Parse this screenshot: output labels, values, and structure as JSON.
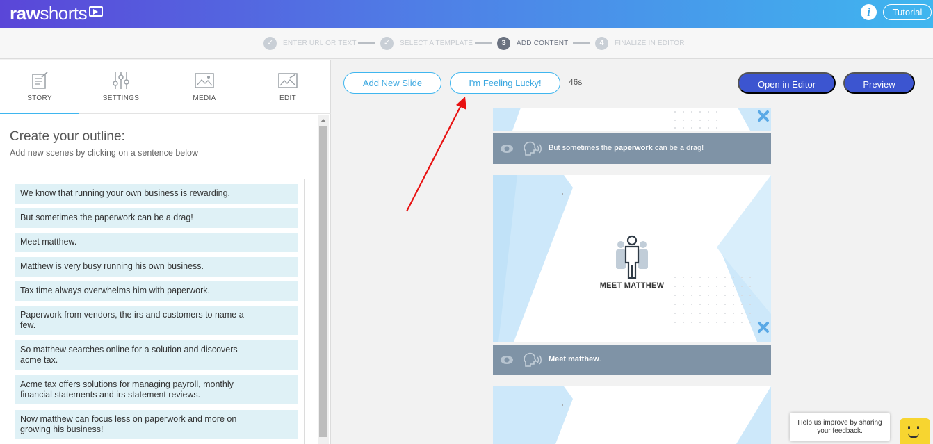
{
  "app": {
    "logo_bold": "raw",
    "logo_thin": "shorts",
    "tutorial_label": "Tutorial",
    "info_glyph": "i"
  },
  "stepper": {
    "steps": [
      {
        "num": "✓",
        "label": "ENTER URL OR TEXT",
        "state": "done"
      },
      {
        "num": "✓",
        "label": "SELECT A TEMPLATE",
        "state": "done"
      },
      {
        "num": "3",
        "label": "ADD CONTENT",
        "state": "active"
      },
      {
        "num": "4",
        "label": "FINALIZE IN EDITOR",
        "state": "pending"
      }
    ]
  },
  "tabs": [
    {
      "label": "STORY",
      "icon": "story-icon",
      "active": true
    },
    {
      "label": "SETTINGS",
      "icon": "settings-sliders-icon",
      "active": false
    },
    {
      "label": "MEDIA",
      "icon": "image-icon",
      "active": false
    },
    {
      "label": "EDIT",
      "icon": "edit-image-icon",
      "active": false
    }
  ],
  "outline": {
    "title": "Create your outline:",
    "subtitle": "Add new scenes by clicking on a sentence below",
    "sentences": [
      "We know that running your own business is rewarding.",
      "But sometimes the paperwork can be a drag!",
      "Meet matthew.",
      "Matthew is very busy running his own business.",
      "Tax time always overwhelms him with paperwork.",
      "Paperwork from vendors, the irs and customers to name a few.",
      "So matthew searches online for a solution and discovers acme tax.",
      "Acme tax offers solutions for managing payroll, monthly financial statements and irs statement reviews.",
      "Now matthew can focus less on paperwork and more on growing his business!"
    ]
  },
  "toolbar": {
    "add_slide": "Add New Slide",
    "feeling_lucky": "I'm Feeling Lucky!",
    "duration": "46s",
    "open_editor": "Open in Editor",
    "preview": "Preview"
  },
  "slides": [
    {
      "caption_pre": "But sometimes the ",
      "caption_bold": "paperwork",
      "caption_post": " can be a drag!"
    },
    {
      "title": "MEET MATTHEW",
      "caption_bold": "Meet matthew",
      "caption_post": "."
    }
  ],
  "feedback": {
    "line1": "Help us improve by sharing",
    "line2": "your feedback."
  },
  "colors": {
    "accent": "#3fb6ef",
    "primary": "#3c55d0",
    "sentence_bg": "#dff1f6",
    "caption_bar": "#7f93a6"
  }
}
